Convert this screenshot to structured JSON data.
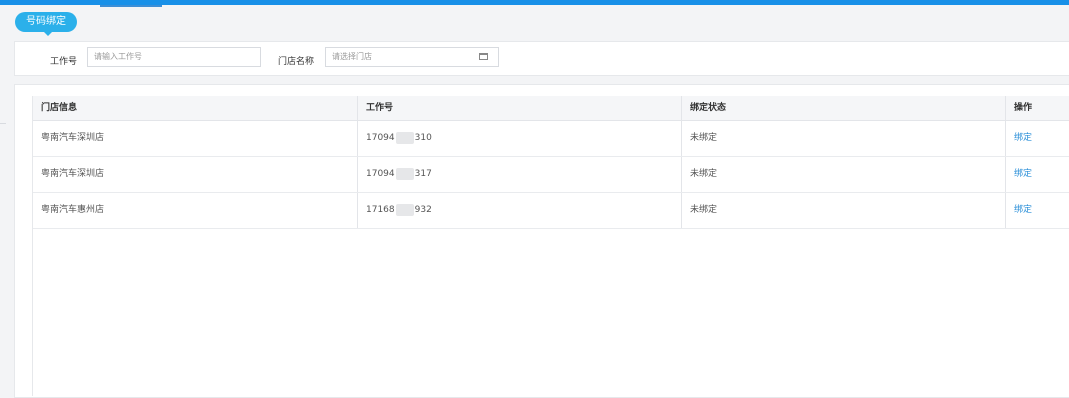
{
  "page": {
    "title": "号码绑定"
  },
  "filters": {
    "job_label": "工作号",
    "job_placeholder": "请输入工作号",
    "store_label": "门店名称",
    "store_placeholder": "请选择门店",
    "calendar_icon": "calendar-icon"
  },
  "table": {
    "headers": [
      "门店信息",
      "工作号",
      "绑定状态",
      "操作"
    ],
    "rows": [
      {
        "store": "粤南汽车深圳店",
        "job_prefix": "17094",
        "job_suffix": "310",
        "status": "未绑定",
        "action": "绑定"
      },
      {
        "store": "粤南汽车深圳店",
        "job_prefix": "17094",
        "job_suffix": "317",
        "status": "未绑定",
        "action": "绑定"
      },
      {
        "store": "粤南汽车惠州店",
        "job_prefix": "17168",
        "job_suffix": "932",
        "status": "未绑定",
        "action": "绑定"
      }
    ]
  },
  "colors": {
    "accent": "#1890e8",
    "pill": "#2bb0ea",
    "link": "#2b8fd8"
  }
}
